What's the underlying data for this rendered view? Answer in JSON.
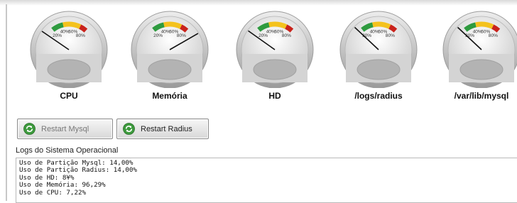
{
  "gauges": [
    {
      "label": "CPU",
      "value_percent": 7.22
    },
    {
      "label": "Memória",
      "value_percent": 96.29
    },
    {
      "label": "HD",
      "value_percent": 8
    },
    {
      "label": "/logs/radius",
      "value_percent": 14.0
    },
    {
      "label": "/var/lib/mysql",
      "value_percent": 14.0
    }
  ],
  "gauge_scale": {
    "tick_20": "20%",
    "tick_40": "40%",
    "tick_60": "60%",
    "tick_80": "80%",
    "zone_colors": {
      "green": "#2e9b3f",
      "yellow": "#f4c21d",
      "red": "#c9221b"
    }
  },
  "buttons": {
    "restart_mysql": "Restart Mysql",
    "restart_radius": "Restart Radius"
  },
  "logs": {
    "title": "Logs do Sistema Operacional",
    "lines": [
      "Uso de Partição Mysql: 14,00%",
      "Uso de Partição Radius: 14,00%",
      "Uso de HD: 8¥%",
      "Uso de Memória: 96,29%",
      "Uso de CPU: 7,22%"
    ]
  }
}
